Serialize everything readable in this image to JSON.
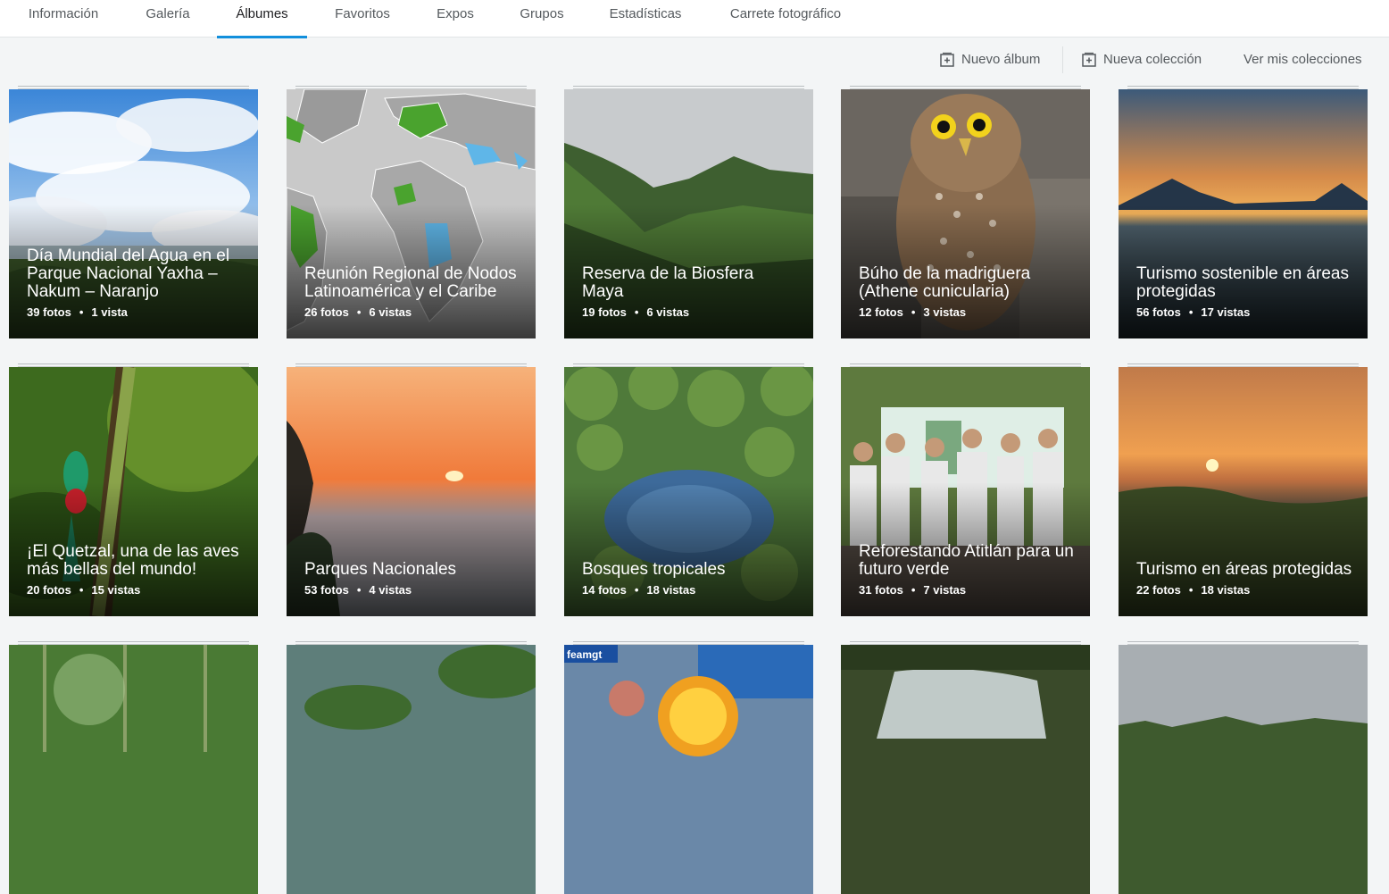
{
  "tabs": [
    {
      "label": "Información"
    },
    {
      "label": "Galería"
    },
    {
      "label": "Álbumes",
      "active": true
    },
    {
      "label": "Favoritos"
    },
    {
      "label": "Expos"
    },
    {
      "label": "Grupos"
    },
    {
      "label": "Estadísticas"
    },
    {
      "label": "Carrete fotográfico"
    }
  ],
  "actions": {
    "new_album": "Nuevo álbum",
    "new_collection": "Nueva colección",
    "view_collections": "Ver mis colecciones"
  },
  "colors": {
    "accent": "#128fdc",
    "background": "#f3f5f6"
  },
  "albums": [
    {
      "title": "Día Mundial del Agua en el Parque Nacional Yaxha – Nakum – Naranjo",
      "photos": "39 fotos",
      "views": "1 vista",
      "scene": "sky"
    },
    {
      "title": "Reunión Regional de Nodos Latinoamérica y el Caribe",
      "photos": "26 fotos",
      "views": "6 vistas",
      "scene": "map"
    },
    {
      "title": "Reserva de la Biosfera Maya",
      "photos": "19 fotos",
      "views": "6 vistas",
      "scene": "mountain"
    },
    {
      "title": "Búho de la madriguera (Athene cunicularia)",
      "photos": "12 fotos",
      "views": "3 vistas",
      "scene": "owl"
    },
    {
      "title": "Turismo sostenible en áreas protegidas",
      "photos": "56 fotos",
      "views": "17 vistas",
      "scene": "volcano"
    },
    {
      "title": "¡El Quetzal, una de las aves más bellas del mundo!",
      "photos": "20 fotos",
      "views": "15 vistas",
      "scene": "quetzal"
    },
    {
      "title": "Parques Nacionales",
      "photos": "53 fotos",
      "views": "4 vistas",
      "scene": "sunset-fog"
    },
    {
      "title": "Bosques tropicales",
      "photos": "14 fotos",
      "views": "18 vistas",
      "scene": "cenote"
    },
    {
      "title": "Reforestando Atitlán para un futuro verde",
      "photos": "31 fotos",
      "views": "7 vistas",
      "scene": "people"
    },
    {
      "title": "Turismo en áreas protegidas",
      "photos": "22 fotos",
      "views": "18 vistas",
      "scene": "sunset-lake"
    },
    {
      "title": "",
      "photos": "",
      "views": "",
      "scene": "jungle"
    },
    {
      "title": "",
      "photos": "",
      "views": "",
      "scene": "aerial-water"
    },
    {
      "title": "",
      "photos": "",
      "views": "",
      "scene": "clock",
      "overlay_text": "feamgt"
    },
    {
      "title": "",
      "photos": "",
      "views": "",
      "scene": "waterfall"
    },
    {
      "title": "",
      "photos": "",
      "views": "",
      "scene": "hazy-forest"
    }
  ]
}
